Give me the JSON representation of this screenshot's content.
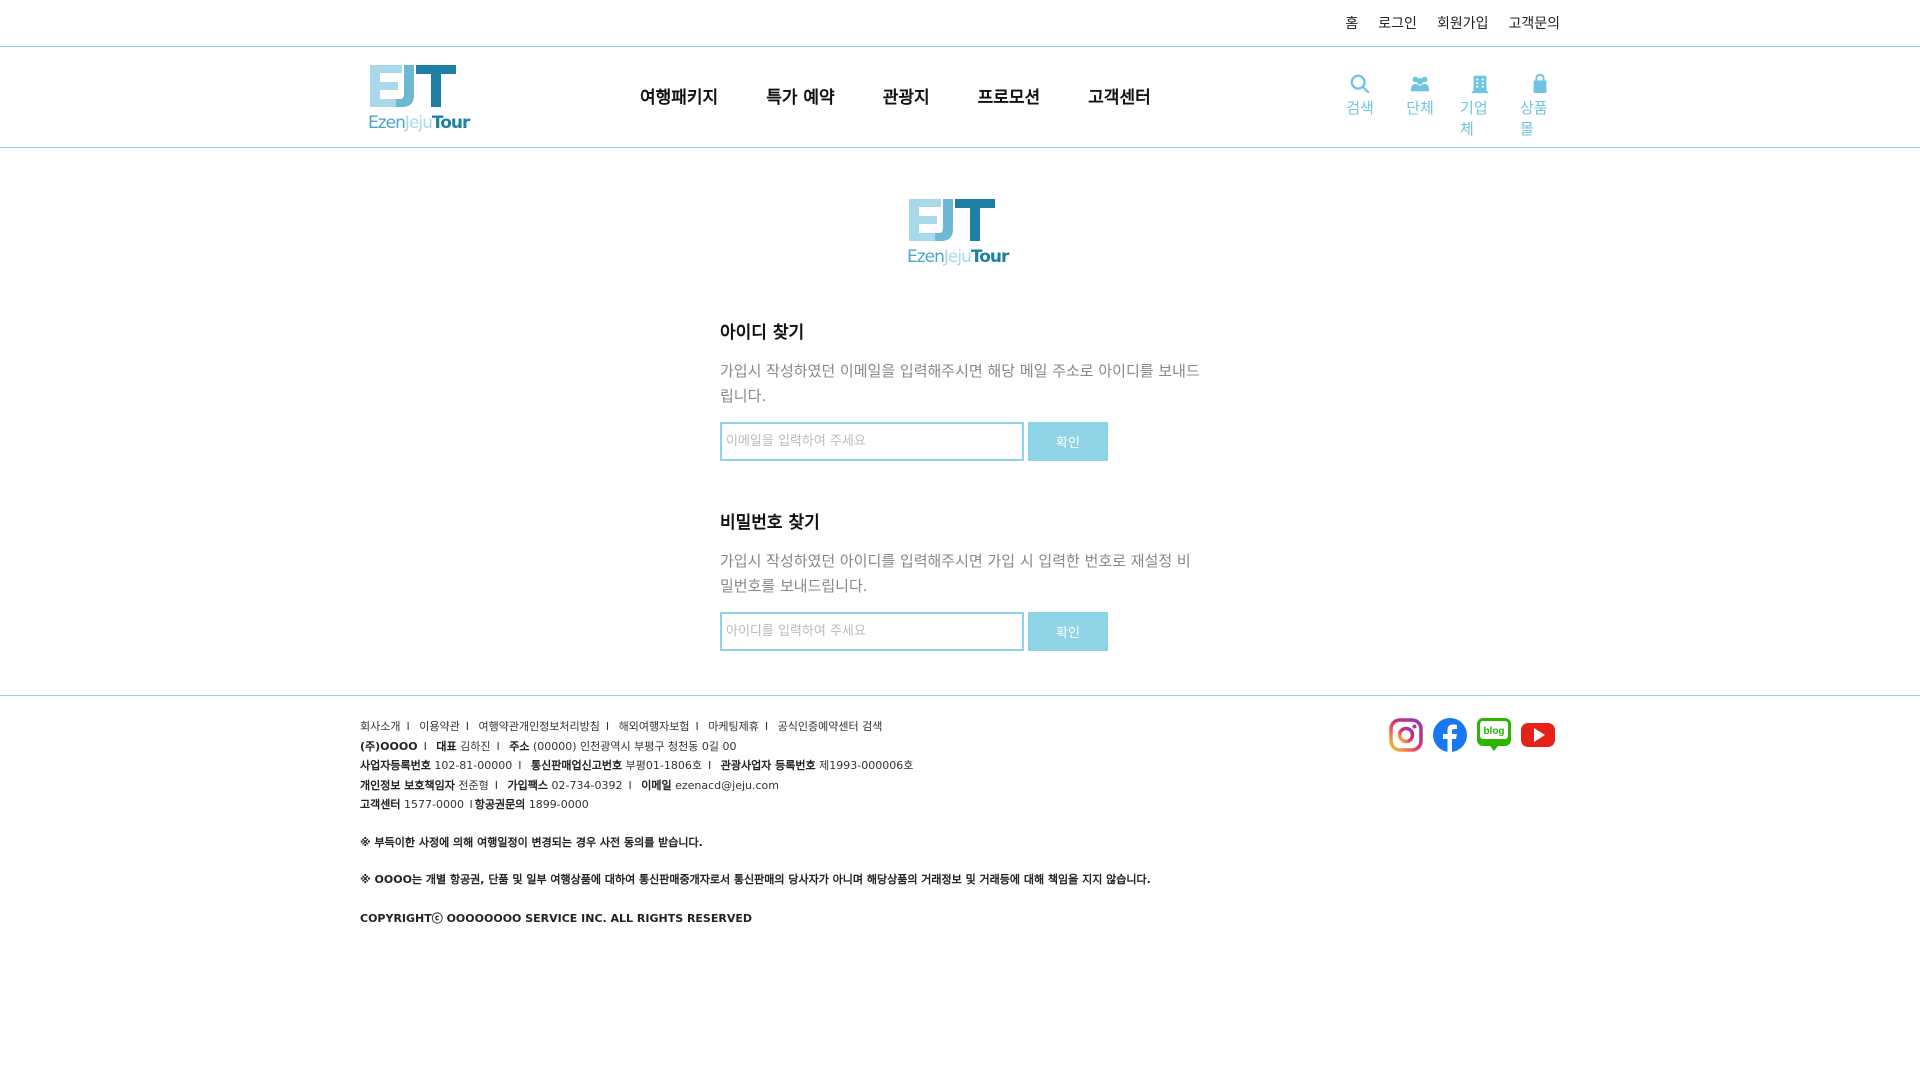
{
  "util_nav": [
    "홈",
    "로그인",
    "회원가입",
    "고객문의"
  ],
  "logo": {
    "mark": "EJT",
    "sub_a": "Ezen",
    "sub_b": "Jeju",
    "sub_c": "Tour"
  },
  "gnb": [
    "여행패키지",
    "특가 예약",
    "관광지",
    "프로모션",
    "고객센터"
  ],
  "quick_links": [
    {
      "label": "검색",
      "icon": "search-icon"
    },
    {
      "label": "단체",
      "icon": "group-icon"
    },
    {
      "label": "기업체",
      "icon": "building-icon"
    },
    {
      "label": "상품몰",
      "icon": "shopping-bag-icon"
    }
  ],
  "find_id": {
    "title": "아이디 찾기",
    "desc": "가입시 작성하였던 이메일을 입력해주시면 해당 메일 주소로 아이디를 보내드립니다.",
    "placeholder": "이메일을 입력하여 주세요",
    "button": "확인"
  },
  "find_pw": {
    "title": "비밀번호 찾기",
    "desc": "가입시 작성하였던 아이디를 입력해주시면 가입 시 입력한 번호로 재설정 비밀번호를 보내드립니다.",
    "placeholder": "아이디를 입력하여 주세요",
    "button": "확인"
  },
  "footer": {
    "links": [
      "회사소개",
      "이용약관",
      "여행약관개인정보처리방침",
      "해외여행자보험",
      "마케팅제휴",
      "공식인증예약센터 검색"
    ],
    "company": "(주)OOOO",
    "ceo_label": "대표",
    "ceo": "김하진",
    "addr_label": "주소",
    "addr": "(00000) 인천광역시 부평구 청천동 0길 00",
    "bizno_label": "사업자등록번호",
    "bizno": "102-81-00000",
    "mailorder_label": "통신판매업신고번호",
    "mailorder": "부평01-1806호",
    "tour_label": "관광사업자 등록번호",
    "tour": "제1993-000006호",
    "privacy_label": "개인정보 보호책임자",
    "privacy": "전준형",
    "fax_label": "가입팩스",
    "fax": "02-734-0392",
    "email_label": "이메일",
    "email": "ezenacd@jeju.com",
    "cs_label": "고객센터",
    "cs": "1577-0000",
    "air_label": "항공권문의",
    "air": "1899-0000",
    "note1": "※ 부득이한 사정에 의해 여행일정이 변경되는 경우 사전 동의를 받습니다.",
    "note2": "※ OOOO는 개별 항공권, 단품 및 일부 여행상품에 대하여 통신판매중개자로서 통신판매의 당사자가 아니며 해당상품의 거래정보 및 거래등에 대해 책임을 지지 않습니다.",
    "copyright": "COPYRIGHTⓒ OOOOOOOO SERVICE INC. ALL RIGHTS RESERVED"
  },
  "sns": [
    {
      "icon": "instagram-icon",
      "color": "#d6249f"
    },
    {
      "icon": "facebook-icon",
      "color": "#1877f2"
    },
    {
      "icon": "blog-icon",
      "color": "#2db400",
      "label": "blog"
    },
    {
      "icon": "youtube-icon",
      "color": "#e62117"
    }
  ],
  "colors": {
    "accent": "#8fd3e6",
    "icon": "#6fc5e1",
    "logo_dark": "#1f7fa3",
    "logo_light": "#9fd4e6"
  }
}
